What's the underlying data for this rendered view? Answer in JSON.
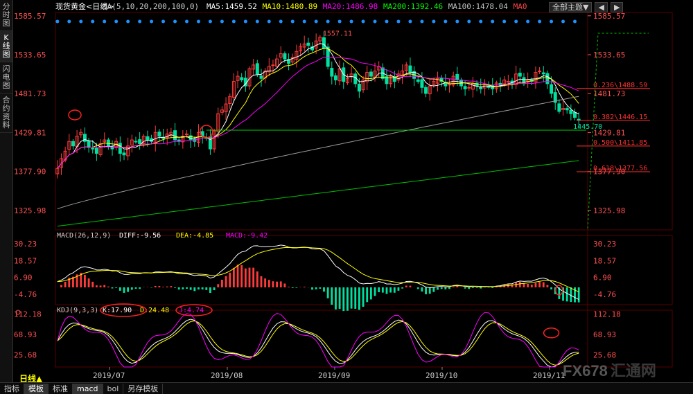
{
  "sidebar": {
    "tabs": [
      {
        "label": "分时图",
        "active": false
      },
      {
        "label": "K线图",
        "active": true
      },
      {
        "label": "闪电图",
        "active": false
      },
      {
        "label": "合约资料",
        "active": false
      }
    ]
  },
  "header": {
    "instrument": "现货黄金<日线>",
    "ma_params": "MA(5,10,20,200,100,0)",
    "ma_values": [
      {
        "label": "MA5:1459.52",
        "color": "#ffffff"
      },
      {
        "label": "MA10:1480.89",
        "color": "#ffff00"
      },
      {
        "label": "MA20:1486.98",
        "color": "#ff00ff"
      },
      {
        "label": "MA200:1392.46",
        "color": "#00ff00"
      },
      {
        "label": "MA100:1478.04",
        "color": "#c0c0c0"
      },
      {
        "label": "MA0",
        "color": "#ff4444"
      }
    ],
    "theme_button": "全部主题▼"
  },
  "main_panel": {
    "price_ticks": [
      "1585.57",
      "1533.65",
      "1481.73",
      "1429.81",
      "1377.90",
      "1325.98"
    ],
    "high_label": "1557.11",
    "low_label": "1445.70",
    "fib_levels": [
      {
        "label": "0.236\\1488.59",
        "value": 1488.59
      },
      {
        "label": "0.382\\1446.15",
        "value": 1446.15
      },
      {
        "label": "0.500\\1411.85",
        "value": 1411.85
      },
      {
        "label": "0.618\\1377.56",
        "value": 1377.56
      }
    ],
    "support_line": 1433
  },
  "macd_panel": {
    "title": "MACD(26,12,9)",
    "diff": "DIFF:-9.56",
    "dea": "DEA:-4.85",
    "macd": "MACD:-9.42",
    "ticks": [
      "30.23",
      "18.57",
      "6.90",
      "-4.76"
    ]
  },
  "kdj_panel": {
    "title": "KDJ(9,3,3)",
    "k": "K:17.90",
    "d": "D:24.48",
    "j": "J:4.74",
    "ticks": [
      "112.18",
      "68.93",
      "25.68"
    ]
  },
  "time_axis": [
    "2019/07",
    "2019/08",
    "2019/09",
    "2019/10",
    "2019/11"
  ],
  "period_button": "日线▲",
  "bottom_tabs": [
    {
      "label": "指标",
      "active": false
    },
    {
      "label": "模板",
      "active": true
    },
    {
      "label": "标准",
      "active": false
    },
    {
      "label": "macd",
      "active": true
    },
    {
      "label": "bol",
      "active": false
    },
    {
      "label": "另存模板",
      "active": false
    }
  ],
  "watermark": {
    "text1": "FX678",
    "text2": "汇通网"
  },
  "colors": {
    "up": "#ff3b3b",
    "down": "#00e0a0",
    "ma5": "#ffffff",
    "ma10": "#ffff00",
    "ma20": "#ff00ff",
    "ma100": "#9a9a9a",
    "ma200": "#00c000",
    "fib": "#ff3030",
    "support": "#00d000",
    "kdj_k": "#ffffff",
    "kdj_d": "#ffff00",
    "kdj_j": "#ff00ff"
  },
  "chart_data": {
    "type": "candlestick",
    "x_range": [
      "2019-06-24",
      "2019-11-13"
    ],
    "ylim": [
      1300,
      1590
    ],
    "closes": [
      1382,
      1395,
      1405,
      1418,
      1412,
      1425,
      1430,
      1418,
      1410,
      1408,
      1402,
      1415,
      1420,
      1412,
      1408,
      1418,
      1402,
      1400,
      1412,
      1420,
      1418,
      1415,
      1425,
      1420,
      1418,
      1430,
      1425,
      1422,
      1428,
      1430,
      1420,
      1418,
      1425,
      1428,
      1420,
      1418,
      1430,
      1425,
      1422,
      1408,
      1432,
      1455,
      1460,
      1468,
      1478,
      1498,
      1505,
      1500,
      1492,
      1515,
      1520,
      1508,
      1502,
      1512,
      1518,
      1520,
      1528,
      1535,
      1528,
      1522,
      1530,
      1538,
      1545,
      1548,
      1546,
      1540,
      1552,
      1557,
      1542,
      1518,
      1505,
      1500,
      1515,
      1498,
      1502,
      1508,
      1495,
      1485,
      1500,
      1510,
      1505,
      1512,
      1518,
      1502,
      1495,
      1505,
      1498,
      1508,
      1512,
      1520,
      1510,
      1502,
      1498,
      1490,
      1482,
      1492,
      1498,
      1502,
      1498,
      1492,
      1495,
      1505,
      1500,
      1492,
      1488,
      1490,
      1495,
      1492,
      1488,
      1494,
      1490,
      1488,
      1496,
      1493,
      1500,
      1498,
      1495,
      1508,
      1505,
      1495,
      1500,
      1498,
      1510,
      1512,
      1508,
      1495,
      1482,
      1470,
      1458,
      1462,
      1460,
      1455,
      1450,
      1446
    ],
    "ma200_last": 1392.46,
    "ma100_last": 1478.04,
    "macd": {
      "diff_last": -9.56,
      "dea_last": -4.85,
      "macd_last": -9.42
    },
    "kdj": {
      "k_last": 17.9,
      "d_last": 24.48,
      "j_last": 4.74
    }
  }
}
